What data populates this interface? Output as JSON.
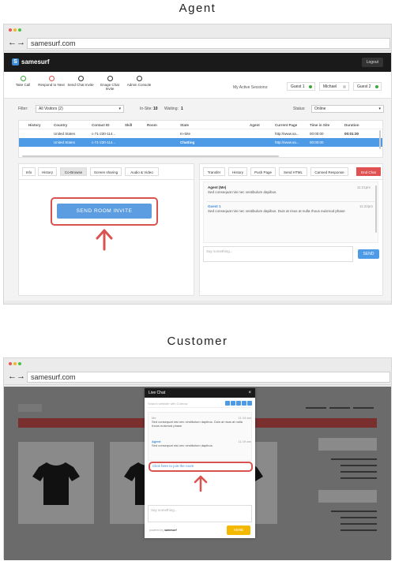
{
  "sections": {
    "agent_title": "Agent",
    "customer_title": "Customer"
  },
  "browser": {
    "url": "samesurf.com"
  },
  "app": {
    "brand": "samesurf",
    "logout": "Logout"
  },
  "toolbar": {
    "tools": [
      "Take Call",
      "Respond to Next",
      "Send Chat Invite",
      "Enage Chat Invite",
      "Admin Console"
    ],
    "sessions_label": "My Active Sessions:",
    "sessions": [
      "Guest 1",
      "Michael",
      "Guest 2"
    ]
  },
  "filter": {
    "label": "Filter:",
    "value": "All Visitors (2)",
    "insite_label": "In-Site:",
    "insite_value": "10",
    "waiting_label": "Waiting:",
    "waiting_value": "1",
    "status_label": "Status:",
    "status_value": "Online"
  },
  "visitors": {
    "headers": [
      "History",
      "Country",
      "Contact ID",
      "Skill",
      "Room",
      "State",
      "Agent",
      "Current Page",
      "Time in Site",
      "Duration"
    ],
    "rows": [
      [
        "",
        "United States",
        "c-71-230-114...",
        "",
        "",
        "In-Site",
        "",
        "http://www.sa...",
        "00:00:00",
        "00:01:30"
      ],
      [
        "",
        "United States",
        "c-71-230-114...",
        "",
        "",
        "Chatting",
        "",
        "http://www.sa...",
        "00:00:00",
        ""
      ]
    ]
  },
  "left_panel": {
    "tabs": [
      "Info",
      "History",
      "Co-Browse",
      "Screen sharing",
      "Audio & Video"
    ],
    "send_invite": "SEND ROOM INVITE"
  },
  "right_panel": {
    "tabs": [
      "Transfer",
      "History",
      "Push Page",
      "Send HTML",
      "Canned Response",
      "End Chat"
    ],
    "messages": [
      {
        "who": "Agent (Me)",
        "text": "Sed consequat nisi nec vestibulum dapibus.",
        "time": "11:21pm"
      },
      {
        "who": "Guest 1",
        "text": "Sed consequat nisi nec vestibulum dapibus. Duis at risus at nulla rhous euismod phase",
        "time": "11:22pm"
      }
    ],
    "placeholder": "Say something...",
    "send": "SEND"
  },
  "widget": {
    "title": "Live Chat",
    "search_placeholder": "Search website with Cobrow",
    "messages": [
      {
        "who": "Me",
        "text": "Sed consequat nisi nec vestibulum dapibus. Duis at risus at nulla rhous euismod phase",
        "time": "11:19 am"
      },
      {
        "who": "Agent",
        "text": "Sed consequat nisi nec vestibulum dapibus.",
        "time": "11:19 am"
      }
    ],
    "join_link": "Click here to join the room",
    "placeholder": "Say something...",
    "powered_by": "powered by",
    "brand": "samesurf",
    "send": "SEND"
  },
  "colors": {
    "accent": "#4d9be6",
    "highlight": "#d9534f",
    "navbar": "#1a1a1a"
  }
}
